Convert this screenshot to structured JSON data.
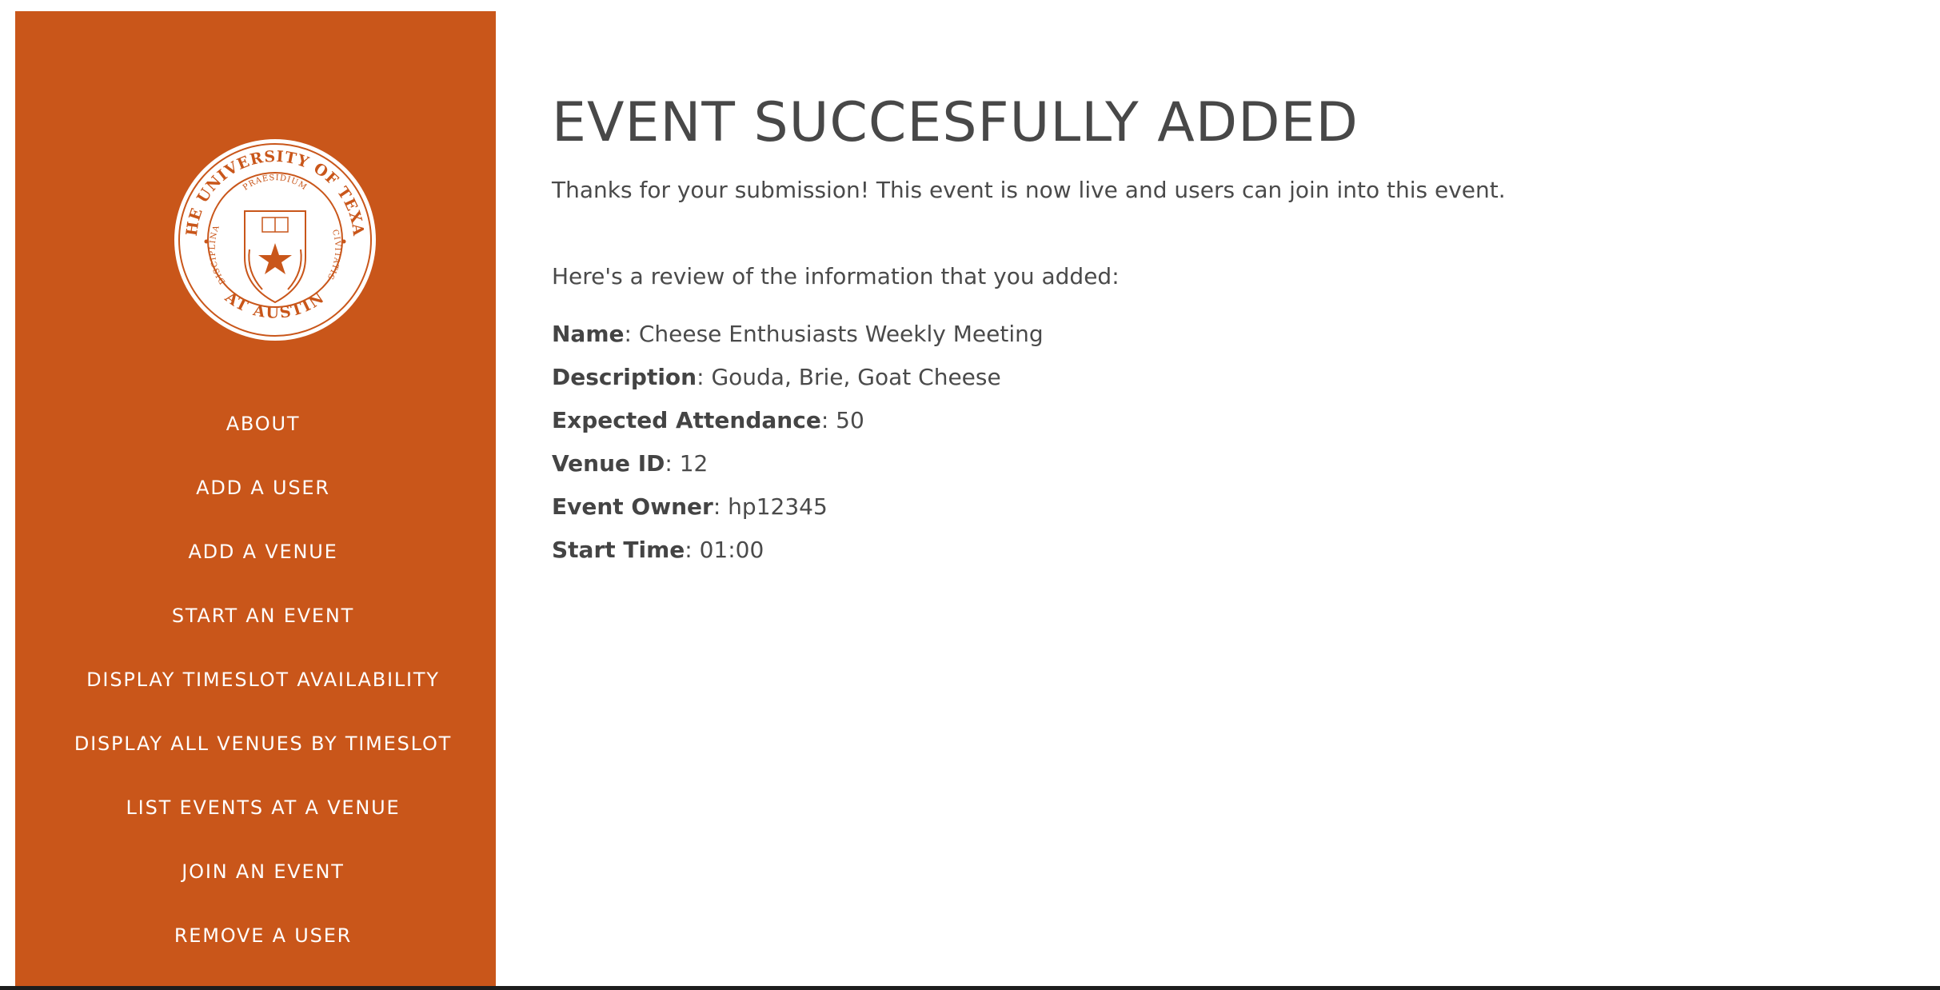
{
  "colors": {
    "sidebar_bg": "#c9561a",
    "text": "#4a4a4a",
    "nav_text": "#ffffff"
  },
  "sidebar": {
    "logo": {
      "icon": "university-of-texas-seal",
      "text_top": "THE UNIVERSITY OF TEXAS",
      "text_bottom": "AT AUSTIN",
      "text_left": "DISCIPLINA",
      "text_right": "CIVITATIS",
      "text_shield": "PRAESIDIUM"
    },
    "items": [
      {
        "label": "ABOUT"
      },
      {
        "label": "ADD A USER"
      },
      {
        "label": "ADD A VENUE"
      },
      {
        "label": "START AN EVENT"
      },
      {
        "label": "DISPLAY TIMESLOT AVAILABILITY"
      },
      {
        "label": "DISPLAY ALL VENUES BY TIMESLOT"
      },
      {
        "label": "LIST EVENTS AT A VENUE"
      },
      {
        "label": "JOIN AN EVENT"
      },
      {
        "label": "REMOVE A USER"
      }
    ]
  },
  "main": {
    "title": "EVENT SUCCESFULLY ADDED",
    "lead": "Thanks for your submission! This event is now live and users can join into this event.",
    "review_intro": "Here's a review of the information that you added:",
    "fields": [
      {
        "label": "Name",
        "value": ": Cheese Enthusiasts Weekly Meeting"
      },
      {
        "label": "Description",
        "value": ": Gouda, Brie, Goat Cheese"
      },
      {
        "label": "Expected Attendance",
        "value": ": 50"
      },
      {
        "label": "Venue ID",
        "value": ": 12"
      },
      {
        "label": "Event Owner",
        "value": ": hp12345"
      },
      {
        "label": "Start Time",
        "value": ": 01:00"
      }
    ]
  }
}
